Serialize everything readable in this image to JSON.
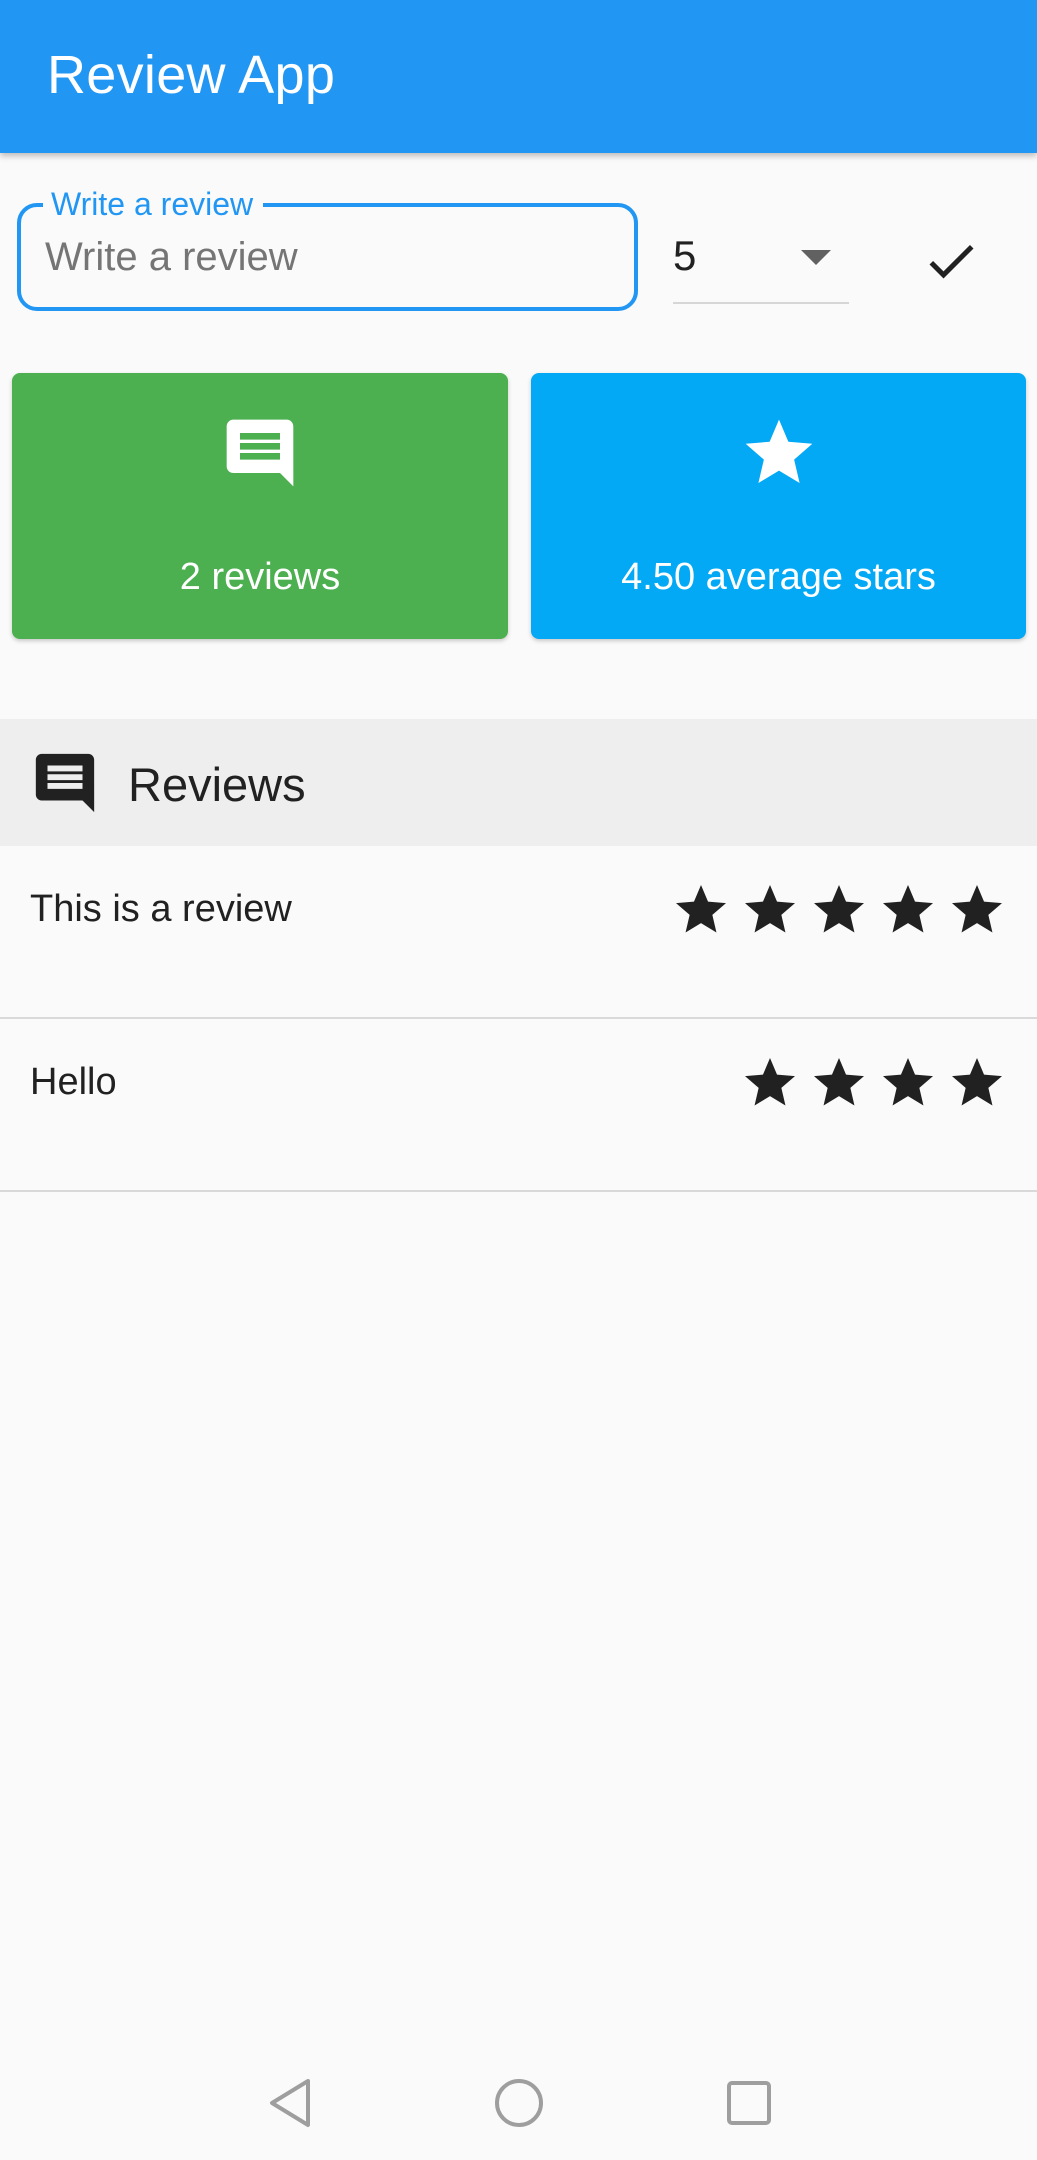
{
  "app_bar": {
    "title": "Review App",
    "color": "#2196f3"
  },
  "review_input": {
    "label": "Write a review",
    "placeholder": "Write a review",
    "value": ""
  },
  "rating_dropdown": {
    "selected": "5"
  },
  "submit": {
    "icon": "check-icon"
  },
  "stats": {
    "review_count": {
      "text": "2 reviews",
      "icon": "comment-icon",
      "color": "#4caf50"
    },
    "average": {
      "text": "4.50 average stars",
      "icon": "star-icon",
      "color": "#03a9f4"
    }
  },
  "reviews_section": {
    "title": "Reviews",
    "icon": "comment-icon"
  },
  "reviews": [
    {
      "text": "This is a review",
      "stars": 5
    },
    {
      "text": "Hello",
      "stars": 4
    }
  ],
  "nav_bar": {
    "buttons": [
      "back-icon",
      "home-icon",
      "recents-icon"
    ]
  }
}
